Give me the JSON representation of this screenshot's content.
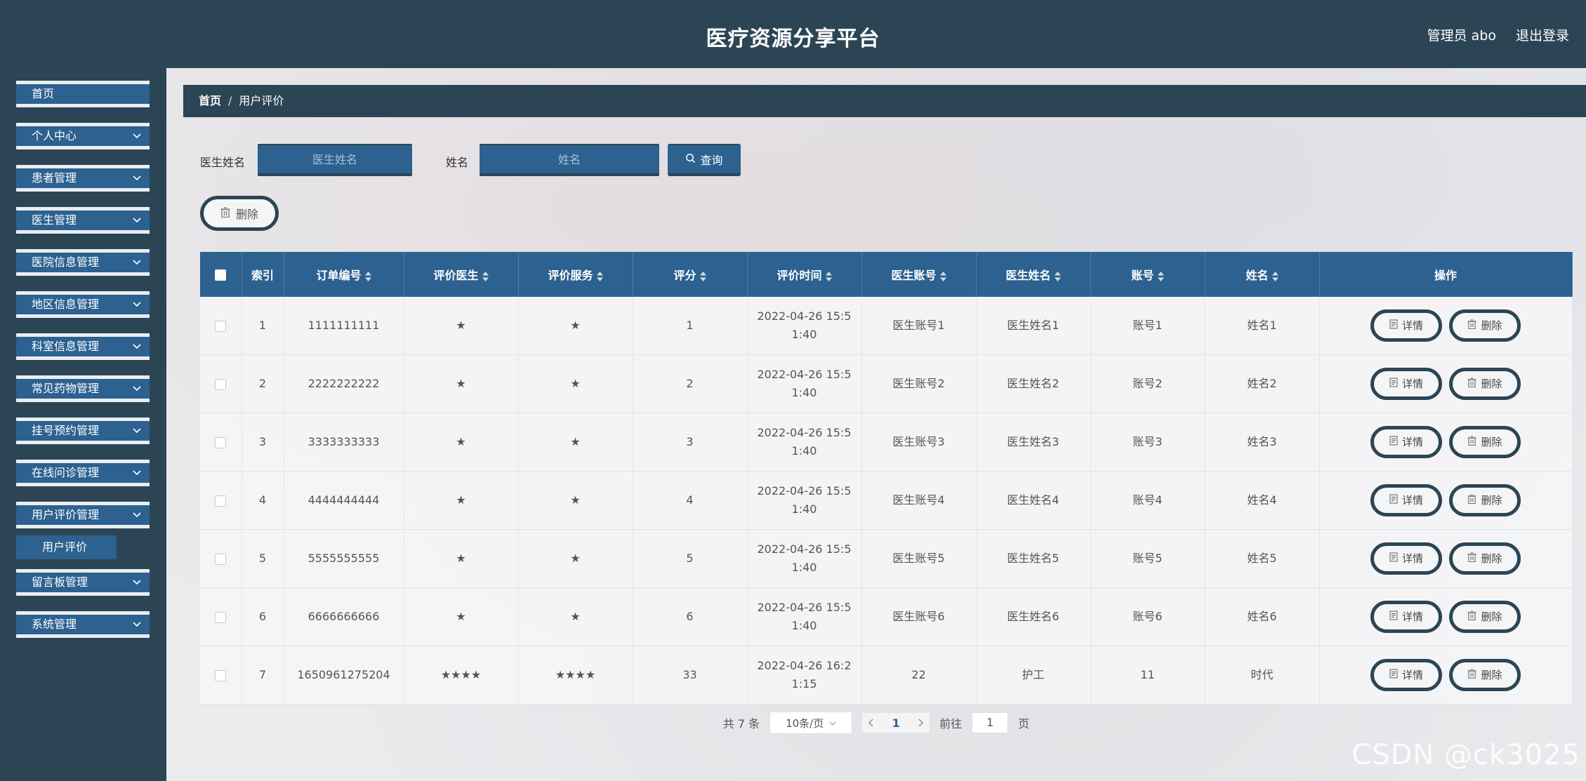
{
  "header": {
    "title": "医疗资源分享平台",
    "user": "管理员 abo",
    "logout": "退出登录"
  },
  "sidebar": {
    "items": [
      {
        "label": "首页",
        "expandable": false
      },
      {
        "label": "个人中心",
        "expandable": true
      },
      {
        "label": "患者管理",
        "expandable": true
      },
      {
        "label": "医生管理",
        "expandable": true
      },
      {
        "label": "医院信息管理",
        "expandable": true
      },
      {
        "label": "地区信息管理",
        "expandable": true
      },
      {
        "label": "科室信息管理",
        "expandable": true
      },
      {
        "label": "常见药物管理",
        "expandable": true
      },
      {
        "label": "挂号预约管理",
        "expandable": true
      },
      {
        "label": "在线问诊管理",
        "expandable": true
      },
      {
        "label": "用户评价管理",
        "expandable": true
      },
      {
        "label": "留言板管理",
        "expandable": true
      },
      {
        "label": "系统管理",
        "expandable": true
      }
    ],
    "sub_item": "用户评价"
  },
  "breadcrumb": {
    "home": "首页",
    "separator": "/",
    "current": "用户评价"
  },
  "search": {
    "doctor_label": "医生姓名",
    "doctor_placeholder": "医生姓名",
    "name_label": "姓名",
    "name_placeholder": "姓名",
    "query_button": "查询"
  },
  "batch_delete": "删除",
  "table": {
    "headers": [
      "索引",
      "订单编号",
      "评价医生",
      "评价服务",
      "评分",
      "评价时间",
      "医生账号",
      "医生姓名",
      "账号",
      "姓名",
      "操作"
    ],
    "rows": [
      {
        "index": "1",
        "order": "1111111111",
        "doctor_rating": "★",
        "service_rating": "★",
        "score": "1",
        "time": "2022-04-26 15:5\n1:40",
        "doctor_account": "医生账号1",
        "doctor_name": "医生姓名1",
        "account": "账号1",
        "name": "姓名1"
      },
      {
        "index": "2",
        "order": "2222222222",
        "doctor_rating": "★",
        "service_rating": "★",
        "score": "2",
        "time": "2022-04-26 15:5\n1:40",
        "doctor_account": "医生账号2",
        "doctor_name": "医生姓名2",
        "account": "账号2",
        "name": "姓名2"
      },
      {
        "index": "3",
        "order": "3333333333",
        "doctor_rating": "★",
        "service_rating": "★",
        "score": "3",
        "time": "2022-04-26 15:5\n1:40",
        "doctor_account": "医生账号3",
        "doctor_name": "医生姓名3",
        "account": "账号3",
        "name": "姓名3"
      },
      {
        "index": "4",
        "order": "4444444444",
        "doctor_rating": "★",
        "service_rating": "★",
        "score": "4",
        "time": "2022-04-26 15:5\n1:40",
        "doctor_account": "医生账号4",
        "doctor_name": "医生姓名4",
        "account": "账号4",
        "name": "姓名4"
      },
      {
        "index": "5",
        "order": "5555555555",
        "doctor_rating": "★",
        "service_rating": "★",
        "score": "5",
        "time": "2022-04-26 15:5\n1:40",
        "doctor_account": "医生账号5",
        "doctor_name": "医生姓名5",
        "account": "账号5",
        "name": "姓名5"
      },
      {
        "index": "6",
        "order": "6666666666",
        "doctor_rating": "★",
        "service_rating": "★",
        "score": "6",
        "time": "2022-04-26 15:5\n1:40",
        "doctor_account": "医生账号6",
        "doctor_name": "医生姓名6",
        "account": "账号6",
        "name": "姓名6"
      },
      {
        "index": "7",
        "order": "1650961275204",
        "doctor_rating": "★★★★",
        "service_rating": "★★★★",
        "score": "33",
        "time": "2022-04-26 16:2\n1:15",
        "doctor_account": "22",
        "doctor_name": "护工",
        "account": "11",
        "name": "时代"
      }
    ],
    "detail_button": "详情",
    "delete_button": "删除"
  },
  "pagination": {
    "total": "共 7 条",
    "page_size": "10条/页",
    "current_page": "1",
    "goto_label": "前往",
    "goto_value": "1",
    "page_suffix": "页"
  },
  "watermark": "CSDN @ck3025",
  "colors": {
    "header_bg": "#2c4555",
    "accent": "#2c6190",
    "table_header": "#2c6190"
  }
}
